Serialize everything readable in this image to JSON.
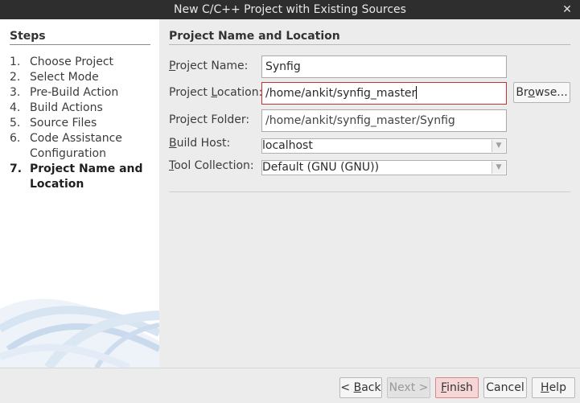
{
  "window": {
    "title": "New C/C++ Project with Existing Sources",
    "close_glyph": "✕"
  },
  "steps": {
    "heading": "Steps",
    "items": [
      {
        "num": "1.",
        "label": "Choose Project"
      },
      {
        "num": "2.",
        "label": "Select Mode"
      },
      {
        "num": "3.",
        "label": "Pre-Build Action"
      },
      {
        "num": "4.",
        "label": "Build Actions"
      },
      {
        "num": "5.",
        "label": "Source Files"
      },
      {
        "num": "6.",
        "label": "Code Assistance Configuration"
      },
      {
        "num": "7.",
        "label": "Project Name and Location"
      }
    ],
    "active_index": 6
  },
  "panel": {
    "heading": "Project Name and Location",
    "project_name": {
      "label_pre": "",
      "label_mn": "P",
      "label_post": "roject Name:",
      "value": "Synfig"
    },
    "project_location": {
      "label_pre": "Project ",
      "label_mn": "L",
      "label_post": "ocation:",
      "value": "/home/ankit/synfig_master"
    },
    "browse": {
      "pre": "Br",
      "mn": "o",
      "post": "wse..."
    },
    "project_folder": {
      "label": "Project Folder:",
      "value": "/home/ankit/synfig_master/Synfig"
    },
    "build_host": {
      "label_pre": "",
      "label_mn": "B",
      "label_post": "uild Host:",
      "value": "localhost"
    },
    "tool_collection": {
      "label_pre": "",
      "label_mn": "T",
      "label_post": "ool Collection:",
      "value": "Default (GNU (GNU))"
    }
  },
  "footer": {
    "back": {
      "pre": "< ",
      "mn": "B",
      "post": "ack"
    },
    "next": {
      "label": "Next >"
    },
    "finish": {
      "pre": "",
      "mn": "F",
      "post": "inish"
    },
    "cancel": {
      "label": "Cancel"
    },
    "help": {
      "pre": "",
      "mn": "H",
      "post": "elp"
    }
  }
}
